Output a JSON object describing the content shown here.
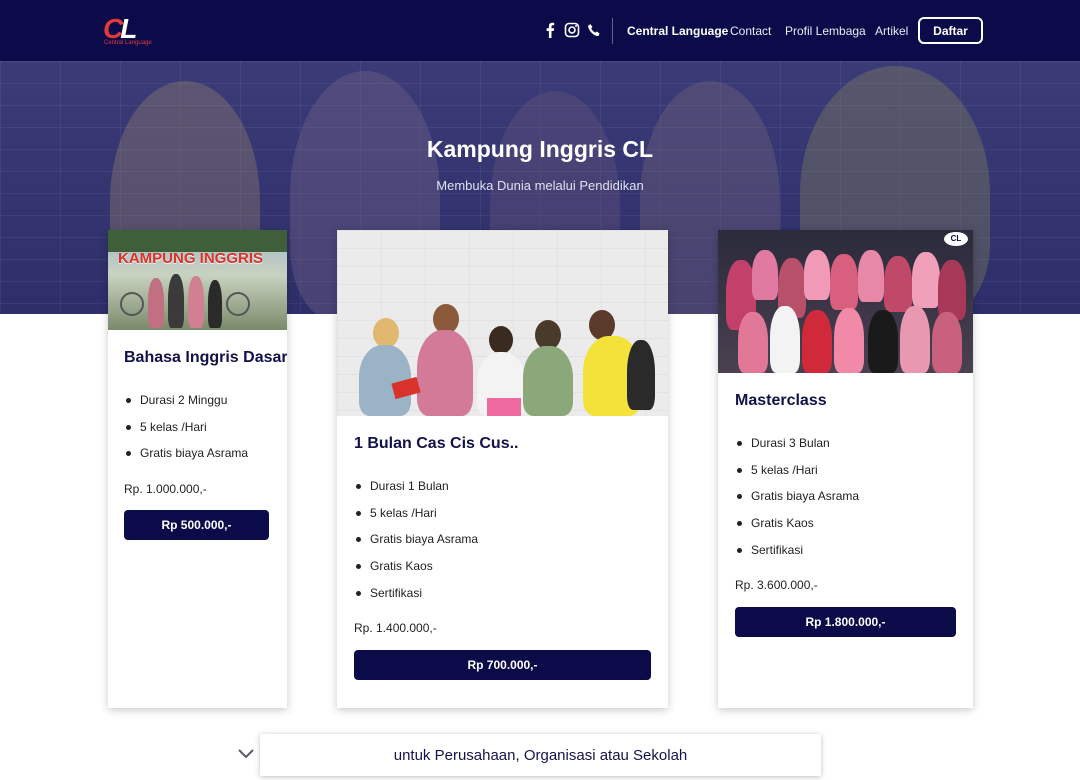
{
  "nav": {
    "logo_text": "CL",
    "logo_tagline": "Central Language",
    "social_icons": [
      "facebook-icon",
      "instagram-icon",
      "phone-icon"
    ],
    "links": [
      "Central Language",
      "Contact",
      "Profil Lembaga",
      "Artikel"
    ],
    "active_link": "Central Language",
    "cta_label": "Daftar"
  },
  "hero": {
    "title": "Kampung Inggris CL",
    "subtitle": "Membuka Dunia melalui Pendidikan"
  },
  "cards": [
    {
      "image_caption": "KAMPUNG INGGRIS",
      "title": "Bahasa Inggris Dasar",
      "features": [
        "Durasi 2 Minggu",
        "5 kelas /Hari",
        "Gratis biaya Asrama"
      ],
      "regular_price": "Rp. 1.000.000,-",
      "button_label": "Rp 500.000,-"
    },
    {
      "title": "1 Bulan Cas Cis Cus..",
      "features": [
        "Durasi 1 Bulan",
        "5 kelas /Hari",
        "Gratis biaya Asrama",
        "Gratis Kaos",
        "Sertifikasi"
      ],
      "regular_price": "Rp. 1.400.000,-",
      "button_label": "Rp 700.000,-"
    },
    {
      "title": "Masterclass",
      "features": [
        "Durasi 3 Bulan",
        "5 kelas /Hari",
        "Gratis biaya Asrama",
        "Gratis Kaos",
        "Sertifikasi"
      ],
      "regular_price": "Rp. 3.600.000,-",
      "button_label": "Rp 1.800.000,-"
    }
  ],
  "bottom": {
    "tab_label": "untuk Perusahaan, Organisasi atau Sekolah"
  },
  "colors": {
    "navy": "#0b0b4a",
    "hero_overlay": "#2e2e6a",
    "brand_red": "#e23a3a"
  }
}
